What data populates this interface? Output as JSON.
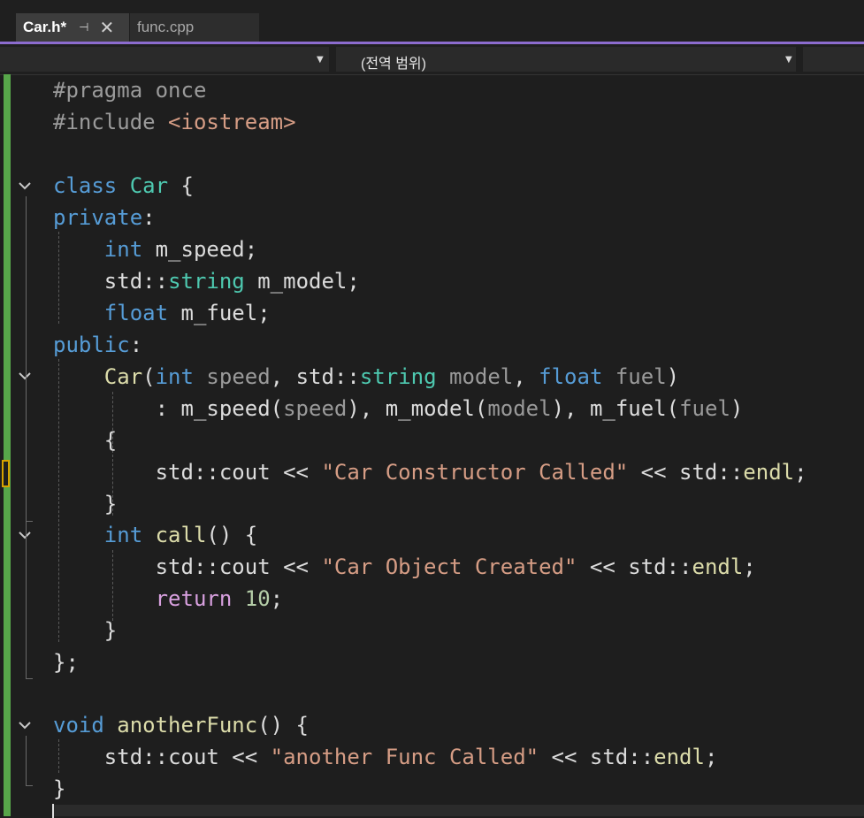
{
  "tabs": [
    {
      "label": "Car.h*",
      "active": true
    },
    {
      "label": "func.cpp",
      "active": false
    }
  ],
  "tab_icons": {
    "pin": "pin-icon",
    "close": "close-icon"
  },
  "navbar": {
    "project_value": "",
    "scope_value": "(전역 범위)",
    "member_value": ""
  },
  "code_lines": [
    "#pragma once",
    "#include <iostream>",
    "",
    "class Car {",
    "private:",
    "    int m_speed;",
    "    std::string m_model;",
    "    float m_fuel;",
    "public:",
    "    Car(int speed, std::string model, float fuel)",
    "        : m_speed(speed), m_model(model), m_fuel(fuel)",
    "    {",
    "        std::cout << \"Car Constructor Called\" << std::endl;",
    "    }",
    "    int call() {",
    "        std::cout << \"Car Object Created\" << std::endl;",
    "        return 10;",
    "    }",
    "};",
    "",
    "void anotherFunc() {",
    "    std::cout << \"another Func Called\" << std::endl;",
    "}"
  ],
  "tokens": {
    "pragma": "#pragma",
    "once": "once",
    "include": "#include",
    "iostream": "<iostream>",
    "class": "class",
    "Car": "Car",
    "private": "private",
    "public": "public",
    "int": "int",
    "float": "float",
    "std": "std",
    "string": "string",
    "cout": "cout",
    "endl": "endl",
    "m_speed": "m_speed",
    "m_model": "m_model",
    "m_fuel": "m_fuel",
    "speed": "speed",
    "model": "model",
    "fuel": "fuel",
    "call": "call",
    "return": "return",
    "ten": "10",
    "void": "void",
    "anotherFunc": "anotherFunc",
    "s1": "\"Car Constructor Called\"",
    "s2": "\"Car Object Created\"",
    "s3": "\"another Func Called\""
  },
  "colors": {
    "keyword": "#569cd6",
    "type": "#4ec9b0",
    "function": "#dcdcaa",
    "string": "#d69d85",
    "number": "#b5cea8",
    "control": "#d8a0df",
    "preprocessor": "#9b9b9b",
    "change_bar": "#57a64a",
    "tab_accent": "#8c6ccf"
  }
}
